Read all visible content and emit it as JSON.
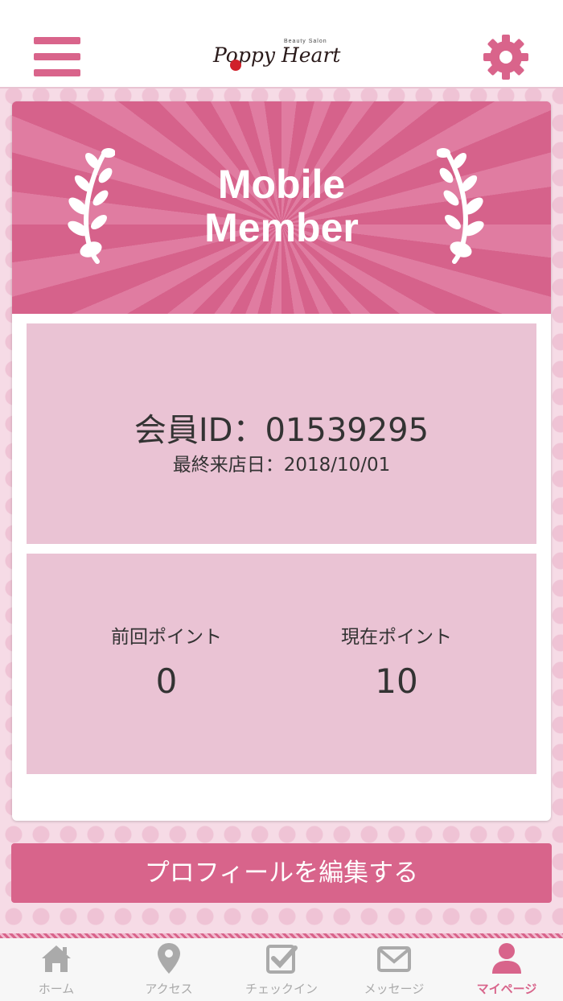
{
  "header": {
    "logo_text": "Poppy Heart",
    "logo_tagline": "Beauty Salon"
  },
  "banner": {
    "title_line1": "Mobile",
    "title_line2": "Member"
  },
  "member": {
    "id_line": "会員ID：01539295",
    "last_visit_line": "最終来店日：2018/10/01"
  },
  "points": {
    "previous_label": "前回ポイント",
    "previous_value": "0",
    "current_label": "現在ポイント",
    "current_value": "10"
  },
  "edit_profile_label": "プロフィールを編集する",
  "tabbar": {
    "items": [
      {
        "label": "ホーム",
        "icon": "home-icon"
      },
      {
        "label": "アクセス",
        "icon": "map-pin-icon"
      },
      {
        "label": "チェックイン",
        "icon": "checkbox-icon"
      },
      {
        "label": "メッセージ",
        "icon": "envelope-icon"
      },
      {
        "label": "マイページ",
        "icon": "user-icon",
        "active": true
      }
    ]
  },
  "colors": {
    "accent": "#d8648b",
    "panel": "#eac3d4",
    "background": "#f6dbe6",
    "inactive_tab": "#aaaaaa"
  }
}
